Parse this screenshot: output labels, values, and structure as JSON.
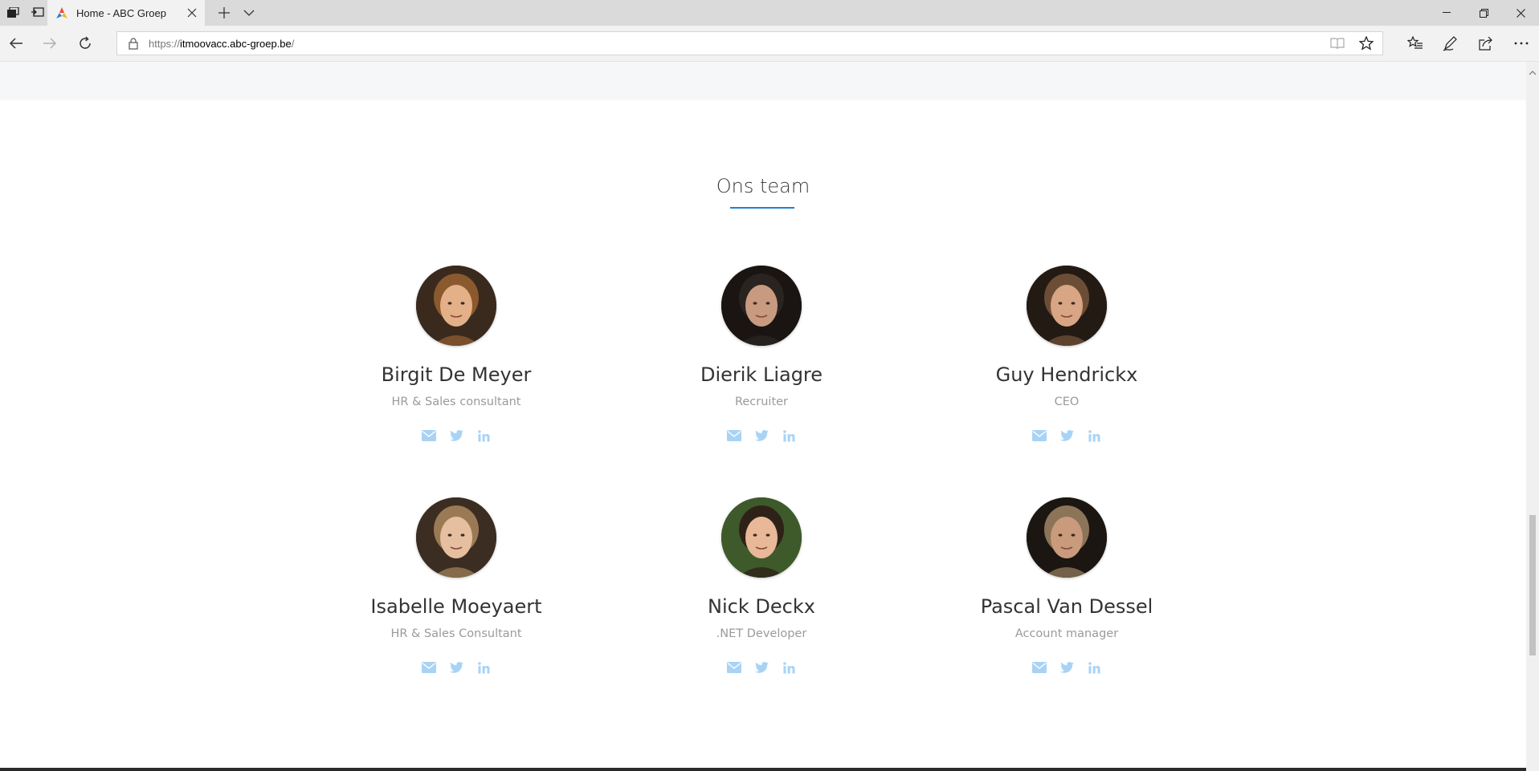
{
  "browser": {
    "tab_title": "Home - ABC Groep",
    "url_protocol": "https://",
    "url_host": "itmoovacc.abc-groep.be",
    "url_path": "/"
  },
  "section": {
    "title": "Ons team"
  },
  "team": [
    {
      "name": "Birgit De Meyer",
      "role": "HR & Sales consultant",
      "hair": "#8a5a2e",
      "skin": "#e3b088",
      "bg": "#3a2a1e"
    },
    {
      "name": "Dierik Liagre",
      "role": "Recruiter",
      "hair": "#2a2420",
      "skin": "#c89a80",
      "bg": "#1a1512"
    },
    {
      "name": "Guy Hendrickx",
      "role": "CEO",
      "hair": "#6b4e35",
      "skin": "#d8a585",
      "bg": "#241a14"
    },
    {
      "name": "Isabelle Moeyaert",
      "role": "HR & Sales Consultant",
      "hair": "#9a7a55",
      "skin": "#e6bfa0",
      "bg": "#3b2d22"
    },
    {
      "name": "Nick Deckx",
      "role": ".NET Developer",
      "hair": "#2e2218",
      "skin": "#e8b898",
      "bg": "#3e5a2a"
    },
    {
      "name": "Pascal Van Dessel",
      "role": "Account manager",
      "hair": "#8b7458",
      "skin": "#c99a7c",
      "bg": "#1c1612"
    }
  ],
  "colors": {
    "accent": "#1e7fd8",
    "social_icon": "#a9d3f5"
  }
}
